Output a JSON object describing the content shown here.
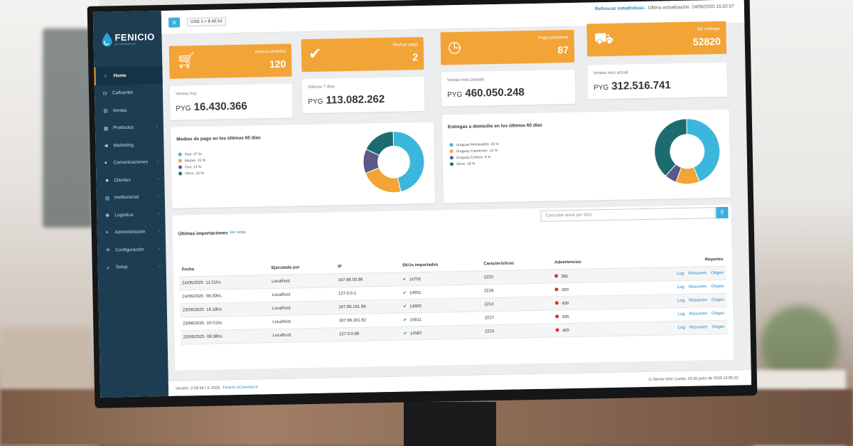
{
  "app": {
    "logo_name": "FENICIO",
    "logo_sub": "ecommerce"
  },
  "sidebar": {
    "items": [
      {
        "label": "Home",
        "icon": "home-icon",
        "glyph": "⌂",
        "chevron": false,
        "active": true
      },
      {
        "label": "Callcenter",
        "icon": "headset-icon",
        "glyph": "☊",
        "chevron": false
      },
      {
        "label": "Ventas",
        "icon": "cart-icon",
        "glyph": "▤",
        "chevron": false
      },
      {
        "label": "Productos",
        "icon": "grid-icon",
        "glyph": "▦",
        "chevron": true
      },
      {
        "label": "Marketing",
        "icon": "megaphone-icon",
        "glyph": "◀",
        "chevron": true
      },
      {
        "label": "Comunicaciones",
        "icon": "chat-icon",
        "glyph": "●",
        "chevron": true
      },
      {
        "label": "Clientes",
        "icon": "users-icon",
        "glyph": "☻",
        "chevron": true
      },
      {
        "label": "Institucional",
        "icon": "bank-icon",
        "glyph": "▥",
        "chevron": true
      },
      {
        "label": "Logística",
        "icon": "pin-icon",
        "glyph": "◉",
        "chevron": true
      },
      {
        "label": "Administración",
        "icon": "sliders-icon",
        "glyph": "≡",
        "chevron": true
      },
      {
        "label": "Configuración",
        "icon": "gears-icon",
        "glyph": "✲",
        "chevron": true
      },
      {
        "label": "Setup",
        "icon": "rocket-icon",
        "glyph": "➹",
        "chevron": true
      }
    ]
  },
  "topbar": {
    "menu_glyph": "≡",
    "fx_rate": "USD 1 = $ 40.54",
    "refresh_link": "Refrescar estadísticas",
    "last_update": " - Última actualización: 24/06/2025 15:02:57"
  },
  "stats": {
    "nuevos_pedidos": {
      "label": "Nuevos pedidos",
      "value": "120"
    },
    "revisar_pago": {
      "label": "Revisar pago",
      "value": "2"
    },
    "pago_pendiente": {
      "label": "Pago pendiente",
      "value": "87"
    },
    "sin_entregar": {
      "label": "Sin entregar",
      "value": "52820"
    },
    "ventas_hoy": {
      "label": "Ventas hoy",
      "currency": "PYG",
      "value": "16.430.366"
    },
    "ultimos_7": {
      "label": "Últimos 7 días",
      "currency": "PYG",
      "value": "113.082.262"
    },
    "mes_pasado": {
      "label": "Ventas mes pasado",
      "currency": "PYG",
      "value": "460.050.248"
    },
    "mes_actual": {
      "label": "Ventas mes actual",
      "currency": "PYG",
      "value": "312.516.741"
    }
  },
  "chart_data": [
    {
      "type": "pie",
      "title": "Medios de pago en los últimos 60 días",
      "categories": [
        "Visa",
        "Master",
        "Oca",
        "Otros"
      ],
      "values": [
        47,
        23,
        13,
        18
      ],
      "colors": [
        "#3bb7dd",
        "#f2a437",
        "#5a5a8a",
        "#1d6b6f"
      ]
    },
    {
      "type": "pie",
      "title": "Entregas a domicilio en los últimos 60 días",
      "categories": [
        "Uruguay Montevideo",
        "Uruguay Canelones",
        "Uruguay Colonia",
        "Otros"
      ],
      "values": [
        45,
        12,
        6,
        39
      ],
      "colors": [
        "#3bb7dd",
        "#f2a437",
        "#5a5a8a",
        "#1d6b6f"
      ]
    }
  ],
  "imports": {
    "title": "Últimas importaciones",
    "link": "Ver todas",
    "search_placeholder": "Consultar stock por SKU",
    "columns": [
      "Fecha",
      "Ejecutada por",
      "IP",
      "SKUs importados",
      "Características",
      "Advertencias",
      "Reportes"
    ],
    "rows": [
      {
        "date": "24/06/2025",
        "time": "11:51hs.",
        "by": "Localhost",
        "ip": "167.96.93.96",
        "skus": "14702",
        "car": "2225",
        "warn": "391"
      },
      {
        "date": "24/06/2025",
        "time": "08:30hs.",
        "by": "Localhost",
        "ip": "127.0.0.1",
        "skus": "14651",
        "car": "2218",
        "warn": "400"
      },
      {
        "date": "23/06/2025",
        "time": "16:18hs.",
        "by": "Localhost",
        "ip": "167.96.161.96",
        "skus": "14600",
        "car": "2214",
        "warn": "400"
      },
      {
        "date": "23/06/2025",
        "time": "10:51hs.",
        "by": "Localhost",
        "ip": "167.96.161.82",
        "skus": "14611",
        "car": "2217",
        "warn": "405"
      },
      {
        "date": "23/06/2025",
        "time": "08:38hs.",
        "by": "Localhost",
        "ip": "127.0.0.96",
        "skus": "14587",
        "car": "2215",
        "warn": "405"
      }
    ],
    "report_links": [
      "Log",
      "Resumen",
      "Origen"
    ]
  },
  "footer": {
    "version": "Versión: 2.59.54 | © 2025,",
    "brand": "Fenicio eCommerce",
    "server_label": "Server time:",
    "server_time": "Lunes, 23 de junio de 2025    12:56:22"
  }
}
